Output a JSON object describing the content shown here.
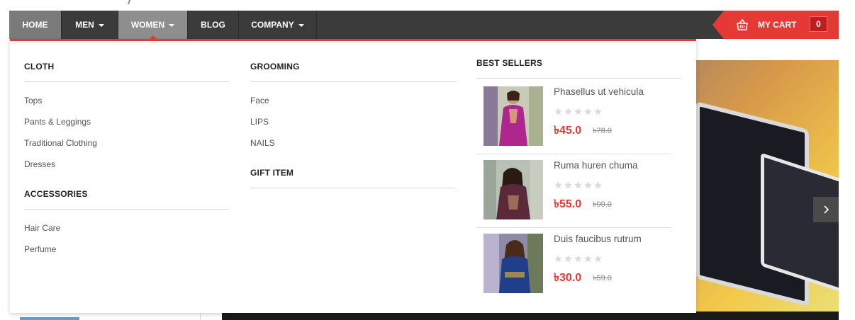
{
  "nav": {
    "home": "HOME",
    "men": "MEN",
    "women": "WOMEN",
    "blog": "BLOG",
    "company": "COMPANY"
  },
  "cart": {
    "label": "MY CART",
    "count": "0"
  },
  "menu": {
    "cloth": {
      "heading": "CLOTH",
      "items": [
        "Tops",
        "Pants & Leggings",
        "Traditional Clothing",
        "Dresses"
      ]
    },
    "accessories": {
      "heading": "ACCESSORIES",
      "items": [
        "Hair Care",
        "Perfume"
      ]
    },
    "grooming": {
      "heading": "GROOMING",
      "items": [
        "Face",
        "LIPS",
        "NAILS"
      ]
    },
    "gift": {
      "heading": "GIFT ITEM"
    },
    "best_sellers": {
      "heading": "BEST SELLERS",
      "products": [
        {
          "name": "Phasellus ut vehicula",
          "price": "৳45.0",
          "old_price": "৳78.0",
          "rating": 0,
          "dress_color": "#b0268f"
        },
        {
          "name": "Ruma huren chuma",
          "price": "৳55.0",
          "old_price": "৳99.0",
          "rating": 0,
          "dress_color": "#5a2a3a"
        },
        {
          "name": "Duis faucibus rutrum",
          "price": "৳30.0",
          "old_price": "৳59.0",
          "rating": 0,
          "dress_color": "#1f3f8a"
        }
      ]
    }
  },
  "colors": {
    "accent": "#e53935",
    "nav_bg": "#3b3b3b"
  },
  "icons": {
    "cart": "basket-icon",
    "next": "chevron-right-icon",
    "star": "star-icon"
  }
}
